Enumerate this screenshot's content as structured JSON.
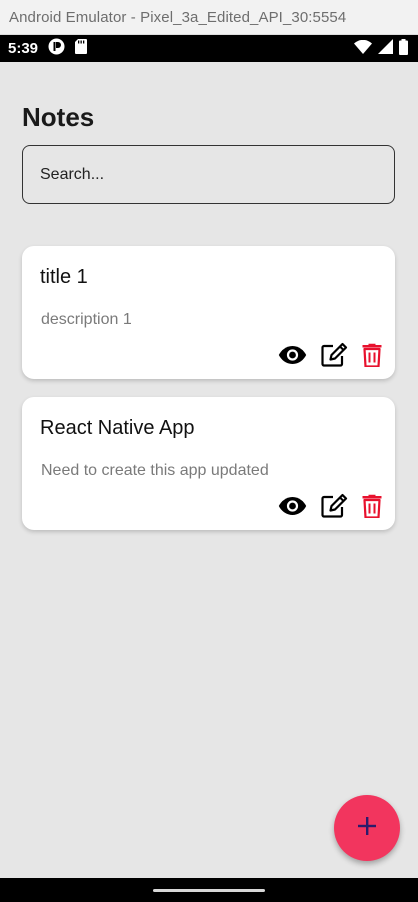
{
  "window": {
    "title": "Android Emulator - Pixel_3a_Edited_API_30:5554"
  },
  "status_bar": {
    "time": "5:39"
  },
  "header": {
    "title": "Notes"
  },
  "search": {
    "placeholder": "Search..."
  },
  "notes": [
    {
      "title": "title 1",
      "description": "description 1"
    },
    {
      "title": "React Native App",
      "description": "Need to create this app updated"
    }
  ],
  "icons": {
    "view": "eye-icon",
    "edit": "edit-icon",
    "delete": "trash-icon",
    "add": "plus-icon"
  },
  "colors": {
    "fab": "#f2355e",
    "delete": "#e8112d",
    "plus": "#2b1b6b"
  }
}
